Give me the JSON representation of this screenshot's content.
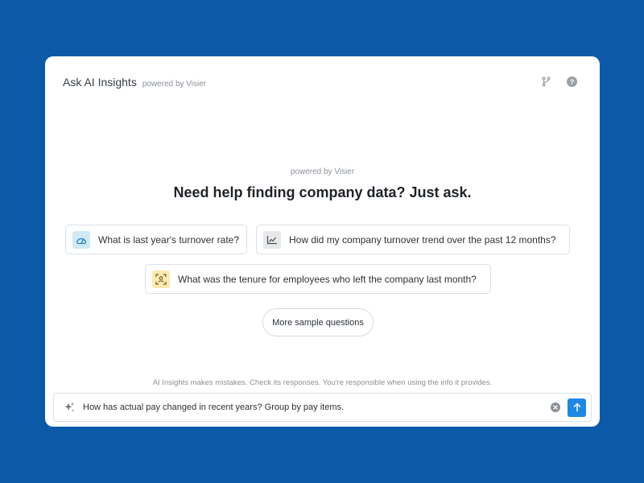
{
  "header": {
    "title": "Ask AI Insights",
    "powered_by": "powered by Visier",
    "icons": [
      "branch-icon",
      "help-icon"
    ]
  },
  "welcome": {
    "powered_by": "powered by Visier",
    "headline": "Need help finding company data? Just ask."
  },
  "suggestions": [
    {
      "text": "What is last year's turnover rate?",
      "icon": "gauge-icon",
      "icon_bg": "#cfe9f7",
      "icon_color": "#2b7fb8"
    },
    {
      "text": "How did my company turnover trend over the past 12 months?",
      "icon": "line-chart-icon",
      "icon_bg": "#e6e8ea",
      "icon_color": "#4a5158"
    },
    {
      "text": "What was the tenure for employees who left the company last month?",
      "icon": "person-focus-icon",
      "icon_bg": "#fbe9b0",
      "icon_color": "#6b5a1e"
    }
  ],
  "more_button": "More sample questions",
  "disclaimer": "AI Insights makes mistakes. Check its responses. You're responsible when using the info it provides.",
  "input": {
    "value": "How has actual pay changed in recent years? Group by pay items."
  },
  "colors": {
    "background": "#0b5aa8",
    "accent": "#1e88e5"
  }
}
